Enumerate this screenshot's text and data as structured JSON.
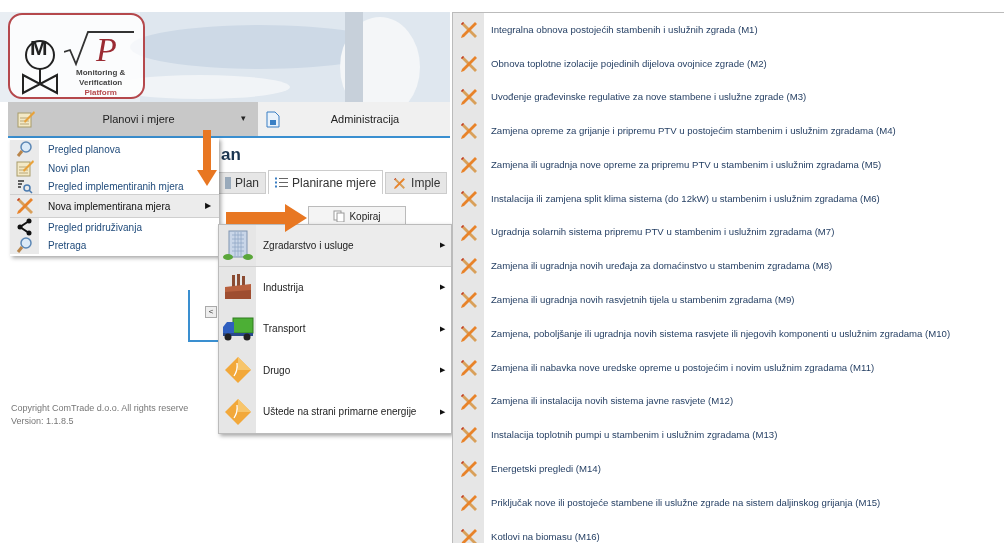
{
  "logo": {
    "mark": "M",
    "root_letter": "P",
    "lines": [
      "Monitoring &",
      "Verification",
      "Platform"
    ]
  },
  "nav": [
    {
      "label": "Planovi i mjere",
      "selected": true,
      "caret": "▾"
    },
    {
      "label": "Administracija",
      "selected": false
    }
  ],
  "page": {
    "heading": "an",
    "tabs": [
      {
        "label": "Plan",
        "selected": false
      },
      {
        "label": "Planirane mjere",
        "selected": true
      },
      {
        "label": "Imple",
        "selected": false
      }
    ],
    "copy_button": "Kopiraj",
    "pager_button": "<"
  },
  "footer": {
    "copyright": "Copyright ComTrade d.o.o. All rights reserve",
    "version": "Version: 1.1.8.5"
  },
  "menu": [
    {
      "label": "Pregled planova",
      "selected": false
    },
    {
      "label": "Novi plan",
      "selected": false
    },
    {
      "label": "Pregled implementiranih mjera",
      "selected": false
    },
    {
      "label": "Nova implementirana mjera",
      "selected": true,
      "arrow": "▶"
    },
    {
      "label": "Pregled pridruživanja",
      "selected": false
    },
    {
      "label": "Pretraga",
      "selected": false
    }
  ],
  "submenu": [
    {
      "label": "Zgradarstvo i usluge",
      "selected": true,
      "arrow": "▶"
    },
    {
      "label": "Industrija",
      "selected": false,
      "arrow": "▶"
    },
    {
      "label": "Transport",
      "selected": false,
      "arrow": "▶"
    },
    {
      "label": "Drugo",
      "selected": false,
      "arrow": "▶"
    },
    {
      "label": "Uštede na strani primarne energije",
      "selected": false,
      "arrow": "▶"
    }
  ],
  "measures": [
    "Integralna obnova postojećih stambenih i uslužnih zgrada (M1)",
    "Obnova toplotne izolacije pojedinih dijelova ovojnice zgrade (M2)",
    "Uvođenje građevinske regulative za nove stambene i uslužne zgrade (M3)",
    "Zamjena opreme za grijanje i pripremu PTV u postojećim stambenim i uslužnim zgradama (M4)",
    "Zamjena ili ugradnja nove opreme za pripremu PTV u stambenim i uslužnim zgradama (M5)",
    "Instalacija ili zamjena split klima sistema (do 12kW) u stambenim i uslužnim zgradama (M6)",
    "Ugradnja solarnih sistema pripremu PTV u stambenim i uslužnim zgradama (M7)",
    "Zamjena ili ugradnja novih uređaja za domaćinstvo u stambenim zgradama (M8)",
    "Zamjena ili ugradnja novih rasvjetnih tijela u stambenim zgradama (M9)",
    "Zamjena, poboljšanje ili ugradnja novih sistema rasvjete ili njegovih komponenti u uslužnim zgradama (M10)",
    "Zamjena ili nabavka nove uredske opreme u postojećim i novim uslužnim zgradama (M11)",
    "Zamjena ili instalacija novih sistema javne rasvjete (M12)",
    "Instalacija toplotnih pumpi u stambenim i uslužnim zgradama (M13)",
    "Energetski pregledi (M14)",
    "Priključak nove ili postojeće stambene ili uslužne zgrade na sistem daljinskog grijanja (M15)",
    "Kotlovi na biomasu (M16)"
  ]
}
